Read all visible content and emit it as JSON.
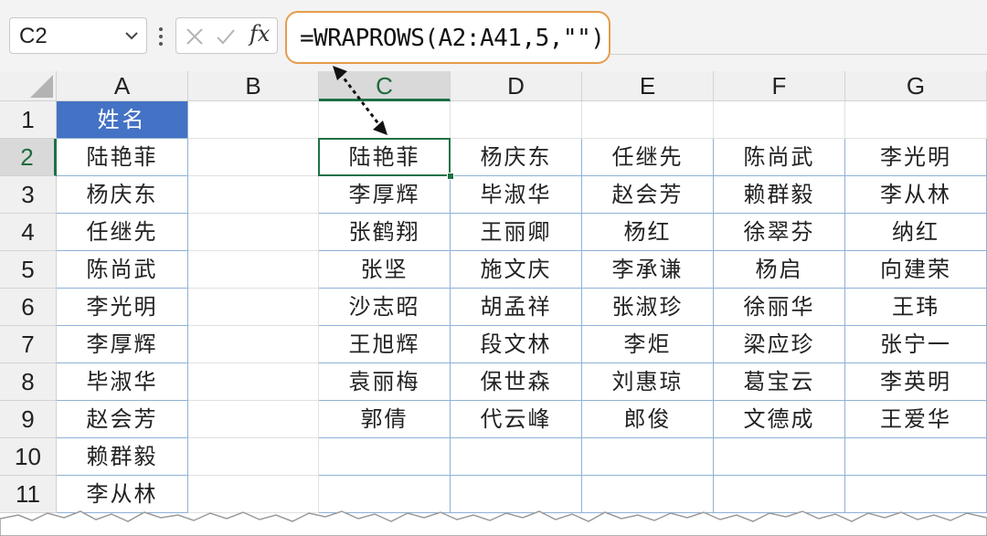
{
  "toolbar": {
    "name_box_value": "C2",
    "fx_label": "fx",
    "formula": "=WRAPROWS(A2:A41,5,\"\")"
  },
  "columns": [
    "A",
    "B",
    "C",
    "D",
    "E",
    "F",
    "G"
  ],
  "rows": [
    "1",
    "2",
    "3",
    "4",
    "5",
    "6",
    "7",
    "8",
    "9",
    "10",
    "11"
  ],
  "active_cell": "C2",
  "column_a": {
    "header": "姓名",
    "values": [
      "陆艳菲",
      "杨庆东",
      "任继先",
      "陈尚武",
      "李光明",
      "李厚辉",
      "毕淑华",
      "赵会芳",
      "赖群毅",
      "李从林"
    ]
  },
  "result_grid": [
    [
      "陆艳菲",
      "杨庆东",
      "任继先",
      "陈尚武",
      "李光明"
    ],
    [
      "李厚辉",
      "毕淑华",
      "赵会芳",
      "赖群毅",
      "李从林"
    ],
    [
      "张鹤翔",
      "王丽卿",
      "杨红",
      "徐翠芬",
      "纳红"
    ],
    [
      "张坚",
      "施文庆",
      "李承谦",
      "杨启",
      "向建荣"
    ],
    [
      "沙志昭",
      "胡孟祥",
      "张淑珍",
      "徐丽华",
      "王玮"
    ],
    [
      "王旭辉",
      "段文林",
      "李炬",
      "梁应珍",
      "张宁一"
    ],
    [
      "袁丽梅",
      "保世森",
      "刘惠琼",
      "葛宝云",
      "李英明"
    ],
    [
      "郭倩",
      "代云峰",
      "郎俊",
      "文德成",
      "王爱华"
    ]
  ],
  "colors": {
    "header_fill": "#4472c4",
    "active_border": "#1e7145",
    "formula_highlight": "#e59c4c",
    "table_border": "#8fb1d6"
  },
  "icons": [
    "chevron-down-icon",
    "more-options-icon",
    "cancel-icon",
    "confirm-icon",
    "insert-function-icon",
    "double-arrow-icon"
  ]
}
